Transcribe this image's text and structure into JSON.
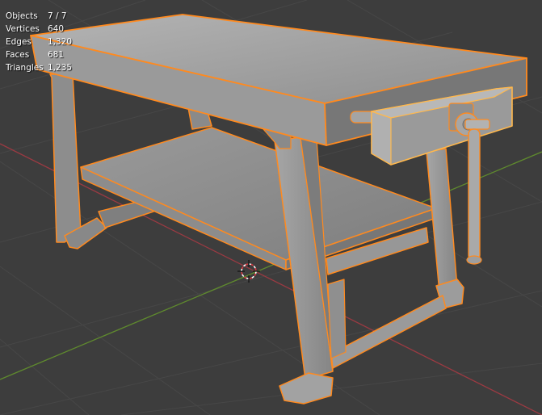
{
  "statistics": {
    "rows": [
      {
        "label": "Objects",
        "value": "7 / 7"
      },
      {
        "label": "Vertices",
        "value": "640"
      },
      {
        "label": "Edges",
        "value": "1,320"
      },
      {
        "label": "Faces",
        "value": "681"
      },
      {
        "label": "Triangles",
        "value": "1,235"
      }
    ]
  },
  "colors": {
    "background": "#3d3d3d",
    "grid_line": "#474747",
    "x_axis": "#9a3a42",
    "y_axis": "#5f8a2e",
    "selection_outline": "#ff8a1f",
    "active_outline": "#ffb84d",
    "mesh_light": "#a8a8a8",
    "mesh_mid": "#8f8f8f",
    "mesh_dark": "#6c6c6c"
  },
  "icons": {
    "origin": "3d-cursor-icon"
  }
}
